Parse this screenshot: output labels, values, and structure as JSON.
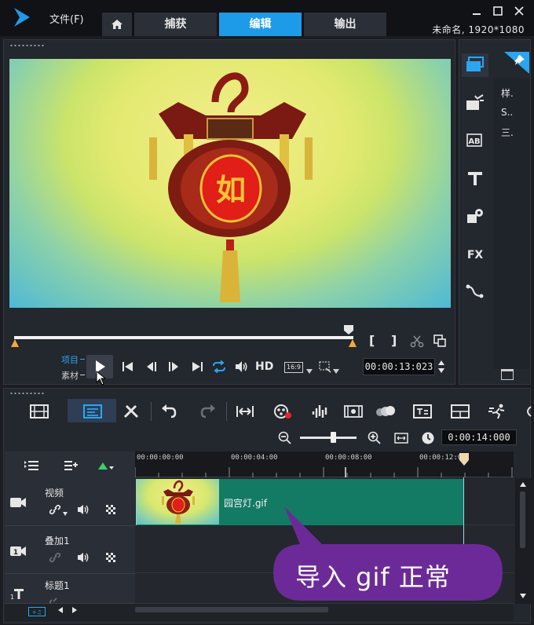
{
  "window": {
    "menu_file": "文件(F)",
    "project_info": "未命名, 1920*1080"
  },
  "tabs": [
    {
      "label": "捕获"
    },
    {
      "label": "编辑",
      "active": true
    },
    {
      "label": "输出"
    }
  ],
  "preview": {
    "mode_project": "项目",
    "mode_clip": "素材",
    "hd_label": "HD",
    "aspect_label": "16:9",
    "timecode": "00:00:13:023",
    "trim_in": "[",
    "trim_out": "]"
  },
  "library": {
    "items": [
      "样.",
      "S..",
      "三."
    ]
  },
  "timeline": {
    "duration": "0:00:14:000",
    "ruler_ticks": [
      "00:00:00:00",
      "00:00:04:00",
      "00:00:08:00",
      "00:00:12:00"
    ],
    "tracks": [
      {
        "name": "视频"
      },
      {
        "name": "叠加1"
      },
      {
        "name": "标题1"
      }
    ],
    "clip": {
      "name": "园宫灯.gif"
    }
  },
  "annotation": {
    "text": "导入 gif 正常"
  },
  "colors": {
    "accent": "#1e9be8",
    "clip": "#137a64",
    "callout": "#6c2a98",
    "panel": "#23272e"
  }
}
